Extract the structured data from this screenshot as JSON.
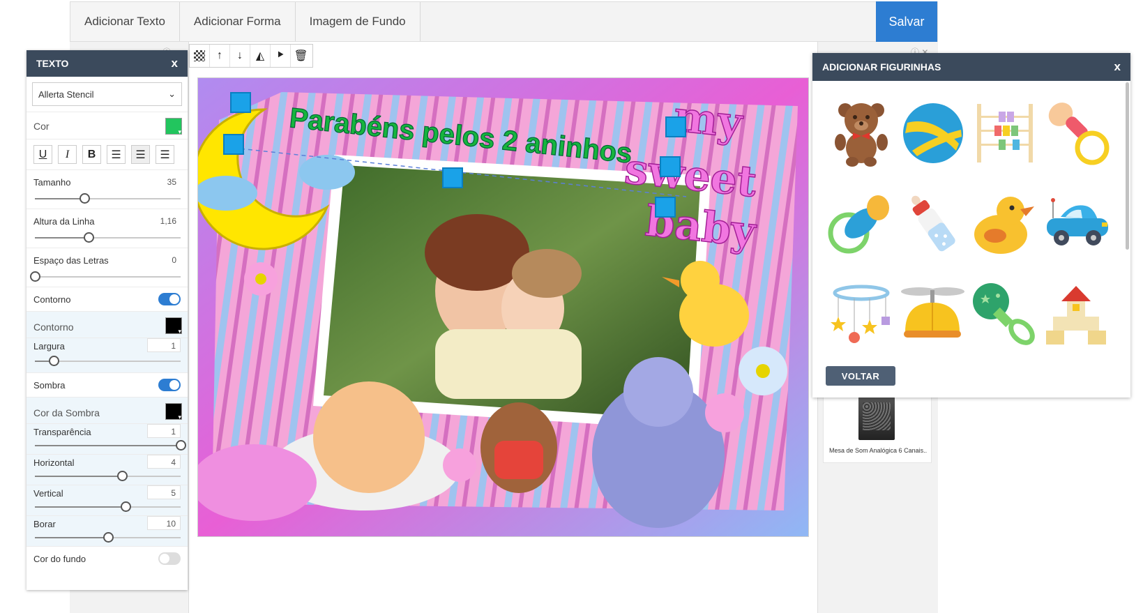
{
  "toolbar": {
    "add_text": "Adicionar Texto",
    "add_shape": "Adicionar Forma",
    "background_image": "Imagem de Fundo",
    "save": "Salvar"
  },
  "canvas": {
    "headline": "Parabéns pelos 2 aninhos",
    "art_text_1": "my",
    "art_text_2": "sweet",
    "art_text_3": "baby"
  },
  "product": {
    "title": "Mesa de Som Analógica 6 Canais..."
  },
  "text_panel": {
    "title": "TEXTO",
    "close": "x",
    "font_value": "Allerta Stencil",
    "color_label": "Cor",
    "color_value": "#22c55e",
    "size_label": "Tamanho",
    "size_value": "35",
    "size_level": 0.34,
    "line_height_label": "Altura da Linha",
    "line_height_value": "1,16",
    "line_height_level": 0.37,
    "letter_spacing_label": "Espaço das Letras",
    "letter_spacing_value": "0",
    "letter_spacing_level": 0.0,
    "outline_toggle_label": "Contorno",
    "outline_color_label": "Contorno",
    "outline_color_value": "#000000",
    "width_label": "Largura",
    "width_value": "1",
    "width_level": 0.13,
    "shadow_toggle_label": "Sombra",
    "shadow_color_label": "Cor da Sombra",
    "shadow_color_value": "#000000",
    "transparency_label": "Transparência",
    "transparency_value": "1",
    "transparency_level": 1.0,
    "horizontal_label": "Horizontal",
    "horizontal_value": "4",
    "horizontal_level": 0.6,
    "vertical_label": "Vertical",
    "vertical_value": "5",
    "vertical_level": 0.62,
    "blur_label": "Borar",
    "blur_value": "10",
    "blur_level": 0.5,
    "bg_color_label": "Cor do fundo"
  },
  "sticker_panel": {
    "title": "ADICIONAR FIGURINHAS",
    "close": "x",
    "back": "VOLTAR",
    "stickers": [
      "teddy-bear",
      "beach-ball",
      "abacus",
      "pacifier-pink",
      "pacifier-blue",
      "baby-bottle",
      "rubber-duck",
      "toy-car",
      "crib-mobile",
      "propeller-cap",
      "rattle",
      "toy-blocks"
    ]
  }
}
